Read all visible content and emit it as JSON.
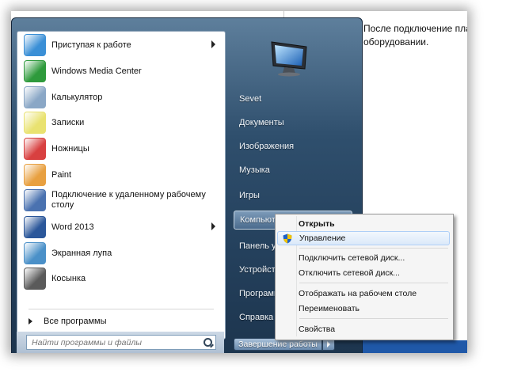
{
  "document": {
    "line1": "После подключение пла",
    "line2": "оборудовании."
  },
  "left_menu": {
    "items": [
      {
        "label": "Приступая к работе",
        "icon": "getting-started-icon",
        "has_arrow": true,
        "color": "#3a8fd6"
      },
      {
        "label": "Windows Media Center",
        "icon": "media-center-icon",
        "has_arrow": false,
        "color": "#2e9a3c"
      },
      {
        "label": "Калькулятор",
        "icon": "calculator-icon",
        "has_arrow": false,
        "color": "#8aa7c6"
      },
      {
        "label": "Записки",
        "icon": "sticky-notes-icon",
        "has_arrow": false,
        "color": "#e9e270"
      },
      {
        "label": "Ножницы",
        "icon": "scissors-icon",
        "has_arrow": false,
        "color": "#d84040"
      },
      {
        "label": "Paint",
        "icon": "paint-icon",
        "has_arrow": false,
        "color": "#e8a040"
      },
      {
        "label": "Подключение к удаленному рабочему столу",
        "label_l1": "Подключение к удаленному рабочему",
        "label_l2": "столу",
        "icon": "remote-desktop-icon",
        "has_arrow": false,
        "color": "#4a72b0"
      },
      {
        "label": "Word 2013",
        "icon": "word-icon",
        "has_arrow": true,
        "color": "#2b579a"
      },
      {
        "label": "Экранная лупа",
        "icon": "magnifier-icon",
        "has_arrow": false,
        "color": "#4a90c8"
      },
      {
        "label": "Косынка",
        "icon": "solitaire-icon",
        "has_arrow": false,
        "color": "#5a5a5a"
      }
    ],
    "all_programs": "Все программы",
    "search_placeholder": "Найти программы и файлы"
  },
  "right_menu": {
    "items": [
      "Sevet",
      "Документы",
      "Изображения",
      "Музыка",
      "Игры",
      "Компьютер",
      "Панель управления",
      "Устройства и принтеры",
      "Программы по умолчанию",
      "Справка и поддержка"
    ],
    "shutdown": "Завершение работы"
  },
  "context_menu": {
    "open": "Открыть",
    "manage": "Управление",
    "map_drive": "Подключить сетевой диск...",
    "disconnect_drive": "Отключить сетевой диск...",
    "show_desktop": "Отображать на рабочем столе",
    "rename": "Переименовать",
    "properties": "Свойства"
  },
  "colors": {
    "accent_blue": "#1f58a8",
    "menu_dark": "#24405c"
  }
}
